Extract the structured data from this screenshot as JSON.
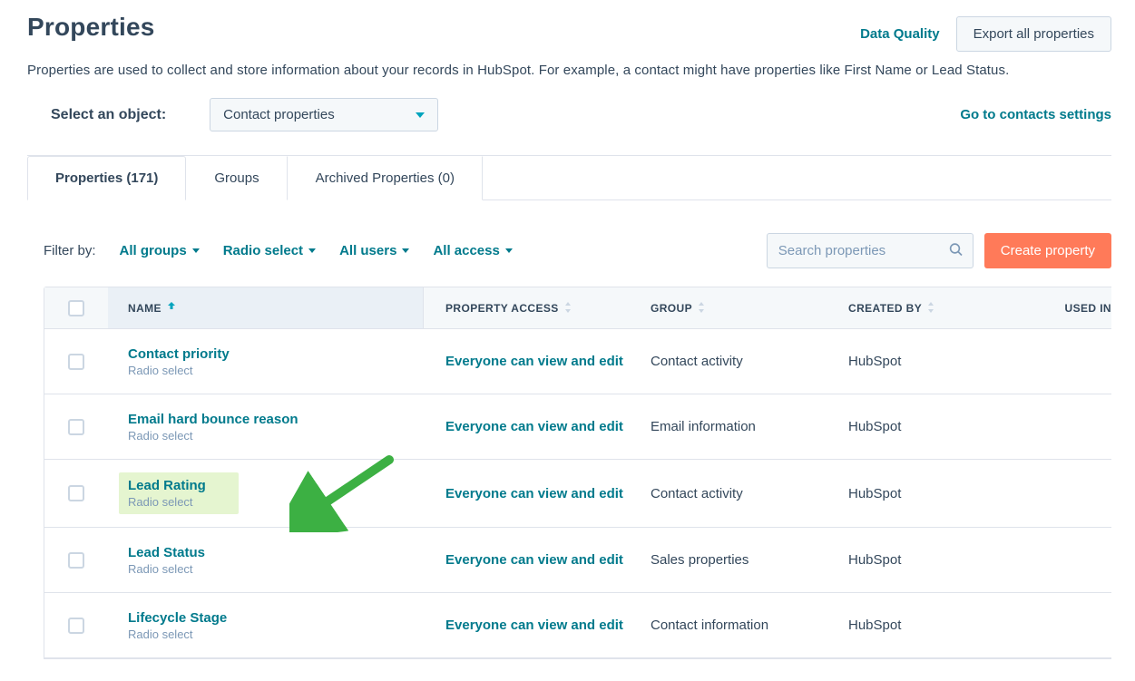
{
  "header": {
    "title": "Properties",
    "data_quality": "Data Quality",
    "export": "Export all properties",
    "subtitle": "Properties are used to collect and store information about your records in HubSpot. For example, a contact might have properties like First Name or Lead Status."
  },
  "objectBar": {
    "label": "Select an object:",
    "selected": "Contact properties",
    "settings_link": "Go to contacts settings"
  },
  "tabs": {
    "properties": "Properties (171)",
    "groups": "Groups",
    "archived": "Archived Properties (0)"
  },
  "filters": {
    "label": "Filter by:",
    "groups": "All groups",
    "type": "Radio select",
    "users": "All users",
    "access": "All access"
  },
  "search": {
    "placeholder": "Search properties"
  },
  "create": "Create property",
  "columns": {
    "name": "NAME",
    "access": "PROPERTY ACCESS",
    "group": "GROUP",
    "created": "CREATED BY",
    "used": "USED IN"
  },
  "rows": [
    {
      "name": "Contact priority",
      "sub": "Radio select",
      "access": "Everyone can view and edit",
      "group": "Contact activity",
      "created": "HubSpot",
      "highlight": false
    },
    {
      "name": "Email hard bounce reason",
      "sub": "Radio select",
      "access": "Everyone can view and edit",
      "group": "Email information",
      "created": "HubSpot",
      "highlight": false
    },
    {
      "name": "Lead Rating",
      "sub": "Radio select",
      "access": "Everyone can view and edit",
      "group": "Contact activity",
      "created": "HubSpot",
      "highlight": true
    },
    {
      "name": "Lead Status",
      "sub": "Radio select",
      "access": "Everyone can view and edit",
      "group": "Sales properties",
      "created": "HubSpot",
      "highlight": false
    },
    {
      "name": "Lifecycle Stage",
      "sub": "Radio select",
      "access": "Everyone can view and edit",
      "group": "Contact information",
      "created": "HubSpot",
      "highlight": false
    }
  ]
}
